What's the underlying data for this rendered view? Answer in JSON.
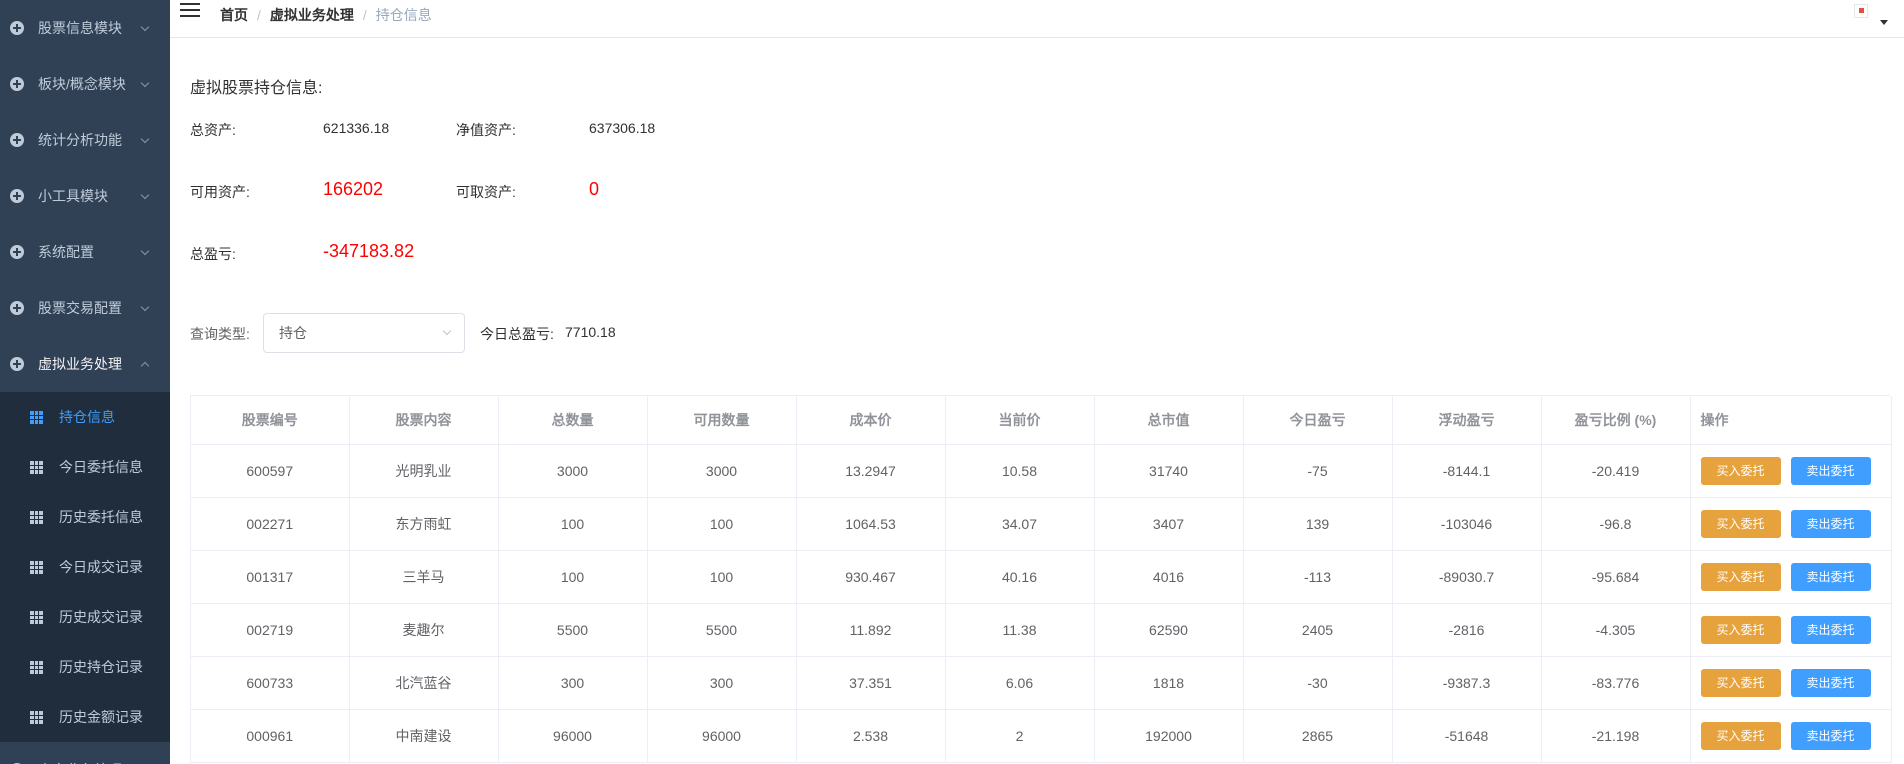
{
  "sidebar": {
    "menus": [
      {
        "label": "股票信息模块"
      },
      {
        "label": "板块/概念模块"
      },
      {
        "label": "统计分析功能"
      },
      {
        "label": "小工具模块"
      },
      {
        "label": "系统配置"
      },
      {
        "label": "股票交易配置"
      },
      {
        "label": "虚拟业务处理"
      }
    ],
    "submenu": [
      {
        "label": "持仓信息"
      },
      {
        "label": "今日委托信息"
      },
      {
        "label": "历史委托信息"
      },
      {
        "label": "今日成交记录"
      },
      {
        "label": "历史成交记录"
      },
      {
        "label": "历史持仓记录"
      },
      {
        "label": "历史金额记录"
      }
    ],
    "last_menu": {
      "label": "真实业务处理"
    }
  },
  "breadcrumb": {
    "home": "首页",
    "sep": "/",
    "section": "虚拟业务处理",
    "page": "持仓信息"
  },
  "summary": {
    "title": "虚拟股票持仓信息:",
    "total_assets_label": "总资产:",
    "total_assets": "621336.18",
    "net_assets_label": "净值资产:",
    "net_assets": "637306.18",
    "available_label": "可用资产:",
    "available": "166202",
    "withdrawable_label": "可取资产:",
    "withdrawable": "0",
    "profit_label": "总盈亏:",
    "profit": "-347183.82"
  },
  "query": {
    "label": "查询类型:",
    "selected": "持仓",
    "today_profit_label": "今日总盈亏:",
    "today_profit": "7710.18"
  },
  "table": {
    "headers": [
      "股票编号",
      "股票内容",
      "总数量",
      "可用数量",
      "成本价",
      "当前价",
      "总市值",
      "今日盈亏",
      "浮动盈亏",
      "盈亏比例 (%)",
      "操作"
    ],
    "buy_label": "买入委托",
    "sell_label": "卖出委托",
    "rows": [
      [
        "600597",
        "光明乳业",
        "3000",
        "3000",
        "13.2947",
        "10.58",
        "31740",
        "-75",
        "-8144.1",
        "-20.419"
      ],
      [
        "002271",
        "东方雨虹",
        "100",
        "100",
        "1064.53",
        "34.07",
        "3407",
        "139",
        "-103046",
        "-96.8"
      ],
      [
        "001317",
        "三羊马",
        "100",
        "100",
        "930.467",
        "40.16",
        "4016",
        "-113",
        "-89030.7",
        "-95.684"
      ],
      [
        "002719",
        "麦趣尔",
        "5500",
        "5500",
        "11.892",
        "11.38",
        "62590",
        "2405",
        "-2816",
        "-4.305"
      ],
      [
        "600733",
        "北汽蓝谷",
        "300",
        "300",
        "37.351",
        "6.06",
        "1818",
        "-30",
        "-9387.3",
        "-83.776"
      ],
      [
        "000961",
        "中南建设",
        "96000",
        "96000",
        "2.538",
        "2",
        "192000",
        "2865",
        "-51648",
        "-21.198"
      ]
    ]
  }
}
